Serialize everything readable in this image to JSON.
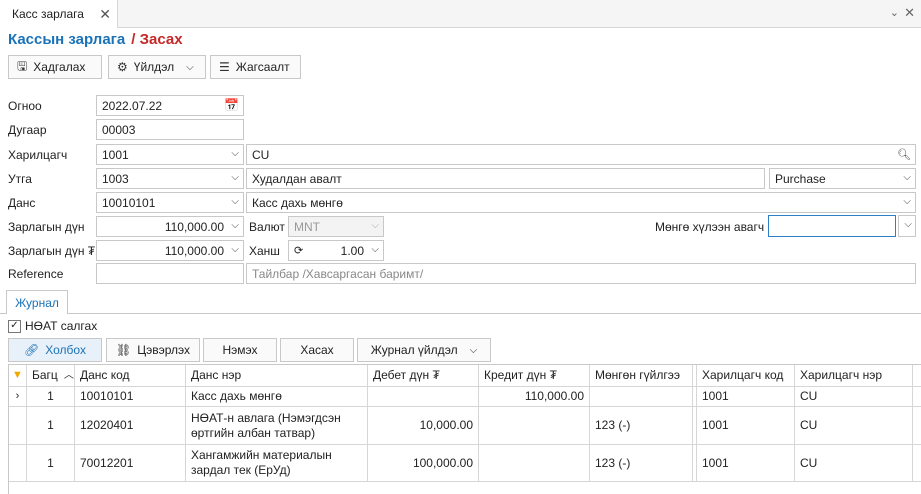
{
  "tab": {
    "title": "Касс зарлага"
  },
  "header": {
    "title": "Кассын зарлага",
    "subtitle": "/ Засах"
  },
  "toolbar": {
    "save": "Хадгалах",
    "action": "Үйлдэл",
    "list": "Жагсаалт"
  },
  "form": {
    "date_label": "Огноо",
    "date_value": "2022.07.22",
    "number_label": "Дугаар",
    "number_value": "00003",
    "partner_label": "Харилцагч",
    "partner_code": "1001",
    "partner_name": "CU",
    "type_label": "Утга",
    "type_code": "1003",
    "type_desc": "Худалдан авалт",
    "type_kind": "Purchase",
    "account_label": "Данс",
    "account_code": "10010101",
    "account_name": "Касс дахь мөнгө",
    "amount_label": "Зарлагын дүн",
    "amount_value": "110,000.00",
    "currency_label": "Валют",
    "currency_value": "MNT",
    "recipient_label": "Мөнгө хүлээн авагч",
    "recipient_value": "",
    "amount_mnt_label": "Зарлагын дүн ₮",
    "amount_mnt_value": "110,000.00",
    "rate_label": "Ханш",
    "rate_value": "1.00",
    "reference_label": "Reference",
    "reference_value": "",
    "note_placeholder": "Тайлбар /Хавсаргасан баримт/"
  },
  "journal": {
    "tab_label": "Журнал",
    "vat_label": "НӨАТ салгах",
    "buttons": {
      "link": "Холбох",
      "clear": "Цэвэрлэх",
      "add": "Нэмэх",
      "delete": "Хасах",
      "action": "Журнал үйлдэл"
    },
    "columns": [
      "Багц",
      "Данс код",
      "Данс нэр",
      "Дебет дүн ₮",
      "Кредит дүн ₮",
      "Мөнгөн гүйлгээ",
      "Харилцагч код",
      "Харилцагч нэр"
    ],
    "rows": [
      {
        "batch": "1",
        "code": "10010101",
        "name": "Касс дахь мөнгө",
        "debit": "",
        "credit": "110,000.00",
        "cash": "",
        "pcode": "1001",
        "pname": "CU"
      },
      {
        "batch": "1",
        "code": "12020401",
        "name": "НӨАТ-н авлага (Нэмэгдсэн өртгийн албан татвар)",
        "debit": "10,000.00",
        "credit": "",
        "cash": "123 (-)",
        "pcode": "1001",
        "pname": "CU"
      },
      {
        "batch": "1",
        "code": "70012201",
        "name": "Хангамжийн материалын зардал тек (ЕрУд)",
        "debit": "100,000.00",
        "credit": "",
        "cash": "123 (-)",
        "pcode": "1001",
        "pname": "CU"
      }
    ]
  },
  "colors": {
    "accent": "#1a73b8",
    "edit": "#c62828"
  }
}
